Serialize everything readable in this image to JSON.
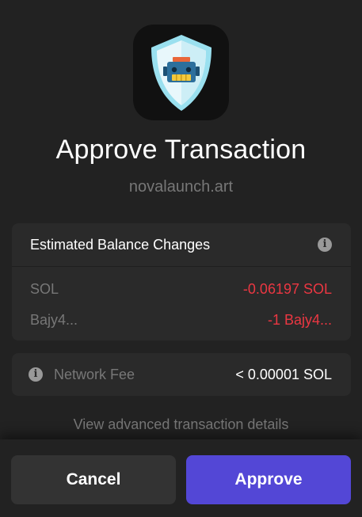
{
  "header": {
    "title": "Approve Transaction",
    "domain": "novalaunch.art"
  },
  "balance_changes": {
    "heading": "Estimated Balance Changes",
    "rows": [
      {
        "label": "SOL",
        "value": "-0.06197 SOL"
      },
      {
        "label": "Bajy4...",
        "value": "-1 Bajy4..."
      }
    ],
    "negative_color": "#eb3742"
  },
  "network_fee": {
    "label": "Network Fee",
    "value": "< 0.00001 SOL"
  },
  "advanced_link": "View advanced transaction details",
  "actions": {
    "cancel_label": "Cancel",
    "approve_label": "Approve",
    "approve_color": "#5347d6"
  },
  "icons": {
    "app_logo": "shield-robot-icon",
    "info": "info-icon"
  }
}
